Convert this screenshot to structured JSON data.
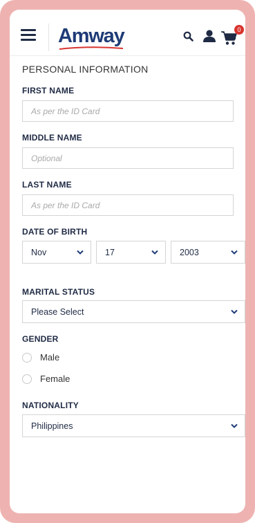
{
  "header": {
    "brand": "Amway",
    "cart_count": "0",
    "colors": {
      "brand_blue": "#1f3b77",
      "brand_red": "#d8342f",
      "frame_pink": "#eeb3b1"
    }
  },
  "form": {
    "section_title": "PERSONAL INFORMATION",
    "first_name": {
      "label": "FIRST NAME",
      "placeholder": "As per the ID Card",
      "value": ""
    },
    "middle_name": {
      "label": "MIDDLE NAME",
      "placeholder": "Optional",
      "value": ""
    },
    "last_name": {
      "label": "LAST NAME",
      "placeholder": "As per the ID Card",
      "value": ""
    },
    "dob": {
      "label": "DATE OF BIRTH",
      "month": "Nov",
      "day": "17",
      "year": "2003"
    },
    "marital_status": {
      "label": "MARITAL STATUS",
      "value": "Please Select"
    },
    "gender": {
      "label": "GENDER",
      "options": [
        "Male",
        "Female"
      ]
    },
    "nationality": {
      "label": "NATIONALITY",
      "value": "Philippines"
    }
  }
}
